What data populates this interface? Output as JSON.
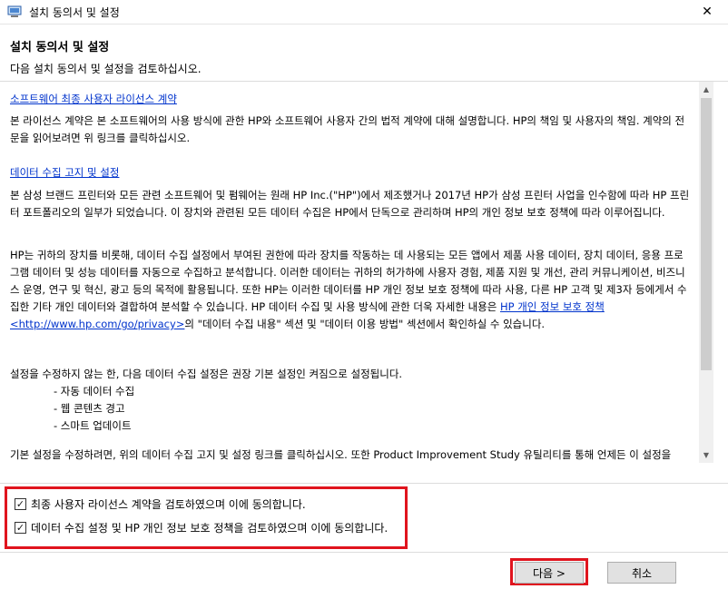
{
  "window": {
    "title": "설치 동의서 및 설정",
    "close_glyph": "✕"
  },
  "header": {
    "title": "설치 동의서 및 설정",
    "subtitle": "다음 설치 동의서 및 설정을 검토하십시오."
  },
  "content": {
    "eula_link": "소프트웨어 최종 사용자 라이선스 계약",
    "eula_text": "본 라이선스 계약은 본 소프트웨어의 사용 방식에 관한 HP와 소프트웨어 사용자 간의 법적 계약에 대해 설명합니다. HP의 책임 및 사용자의 책임. 계약의 전문을 읽어보려면 위 링크를 클릭하십시오.",
    "data_link": "데이터 수집 고지 및 설정",
    "data_text1": "본 삼성 브랜드 프린터와 모든 관련 소프트웨어 및 펌웨어는 원래 HP Inc.(\"HP\")에서 제조했거나 2017년 HP가 삼성 프린터 사업을 인수함에 따라 HP 프린터 포트폴리오의 일부가 되었습니다. 이 장치와 관련된 모든 데이터 수집은 HP에서 단독으로 관리하며 HP의 개인 정보 보호 정책에 따라 이루어집니다.",
    "data_text2_a": "HP는 귀하의 장치를 비롯해, 데이터 수집 설정에서 부여된 권한에 따라 장치를 작동하는 데 사용되는 모든 앱에서 제품 사용 데이터, 장치 데이터, 응용 프로그램 데이터 및 성능 데이터를 자동으로 수집하고 분석합니다. 이러한 데이터는 귀하의 허가하에 사용자 경험, 제품 지원 및 개선, 관리 커뮤니케이션, 비즈니스 운영, 연구 및 혁신, 광고 등의 목적에 활용됩니다. 또한 HP는 이러한 데이터를 HP 개인 정보 보호 정책에 따라 사용, 다른 HP 고객 및 제3자 등에게서 수집한 기타 개인 데이터와 결합하여 분석할 수 있습니다. HP 데이터 수집 및 사용 방식에 관한 더욱 자세한 내용은 ",
    "privacy_link": "HP 개인 정보 보호 정책 <http://www.hp.com/go/privacy>",
    "data_text2_b": "의 \"데이터 수집 내용\" 섹션 및 \"데이터 이용 방법\" 섹션에서 확인하실 수 있습니다.",
    "data_text3": "설정을 수정하지 않는 한, 다음 데이터 수집 설정은 권장 기본 설정인 켜짐으로 설정됩니다.",
    "bullets": [
      "- 자동 데이터 수집",
      "- 웹 콘텐츠 경고",
      "- 스마트 업데이트"
    ],
    "data_text4": "기본 설정을 수정하려면, 위의 데이터 수집 고지 및 설정 링크를 클릭하십시오. 또한 Product Improvement Study 유틸리티를 통해 언제든 이 설정을"
  },
  "agreements": {
    "eula_checkbox": {
      "label": "최종 사용자 라이선스 계약을 검토하였으며 이에 동의합니다.",
      "checked": true
    },
    "data_checkbox": {
      "label": "데이터 수집 설정 및 HP 개인 정보 보호 정책을 검토하였으며 이에 동의합니다.",
      "checked": true
    },
    "check_glyph": "✓"
  },
  "buttons": {
    "next": "다음 >",
    "cancel": "취소"
  },
  "colors": {
    "highlight": "#e0141e",
    "link": "#0033cc"
  }
}
